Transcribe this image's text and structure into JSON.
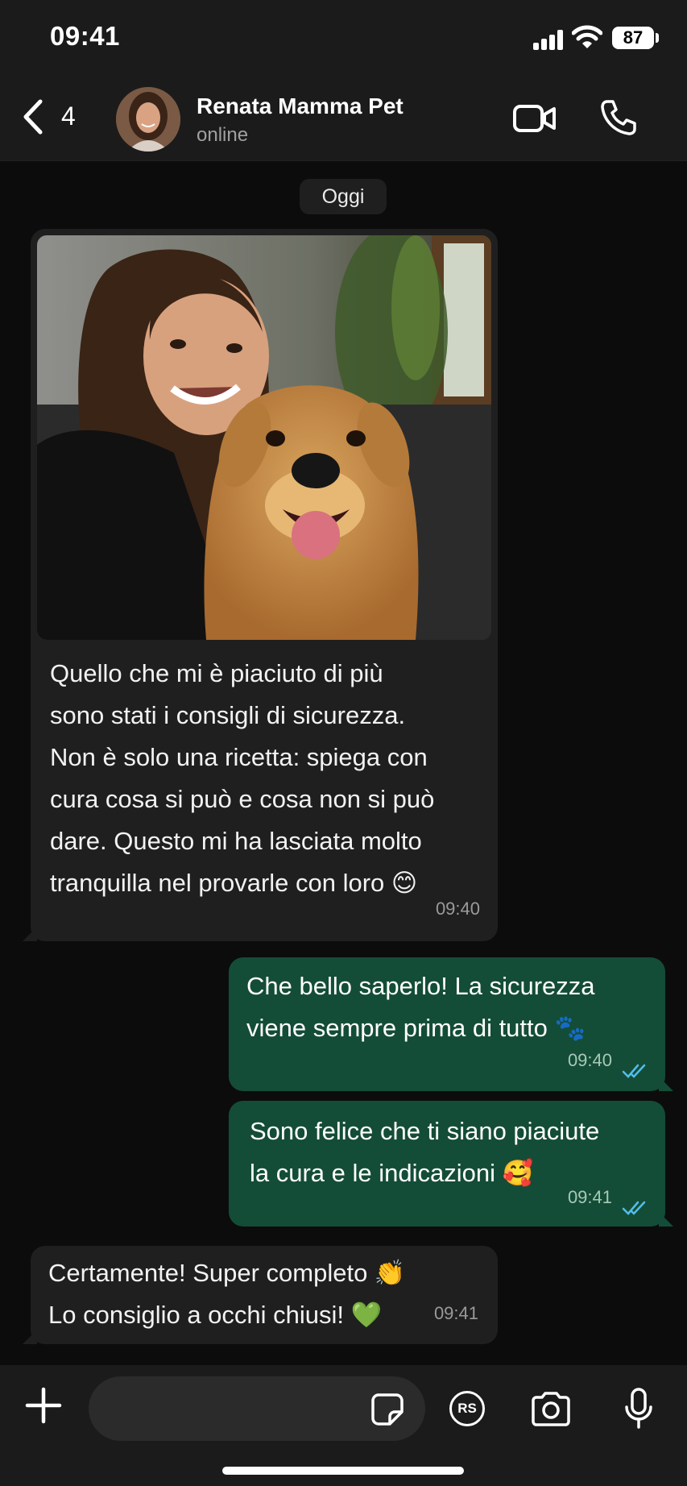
{
  "status_bar": {
    "time": "09:41",
    "battery": "87"
  },
  "header": {
    "back_count": "4",
    "contact_name": "Renata Mamma Pet",
    "contact_status": "online"
  },
  "chat": {
    "date_label": "Oggi",
    "messages": [
      {
        "direction": "in",
        "has_photo": true,
        "lines": [
          "Quello che mi è piaciuto di più",
          "sono stati i consigli di sicurezza.",
          "Non è solo una ricetta: spiega con",
          "cura cosa si può e cosa non si può",
          "dare. Questo mi ha lasciata molto",
          "tranquilla nel provarle con loro 😊"
        ],
        "time": "09:40"
      },
      {
        "direction": "out",
        "lines": [
          "Che bello saperlo! La sicurezza",
          "viene sempre prima di tutto 🐾"
        ],
        "time": "09:40",
        "status": "read"
      },
      {
        "direction": "out",
        "lines": [
          "Sono felice che ti siano piaciute",
          "la cura e le indicazioni 🥰"
        ],
        "time": "09:41",
        "status": "read"
      },
      {
        "direction": "in",
        "lines": [
          "Certamente! Super completo 👏",
          "Lo consiglio a occhi chiusi! 💚"
        ],
        "time": "09:41"
      }
    ]
  },
  "composer": {
    "rs_label": "RS"
  },
  "colors": {
    "incoming_bubble": "#1f1f1f",
    "outgoing_bubble": "#144d37",
    "read_ticks": "#53bdeb"
  }
}
